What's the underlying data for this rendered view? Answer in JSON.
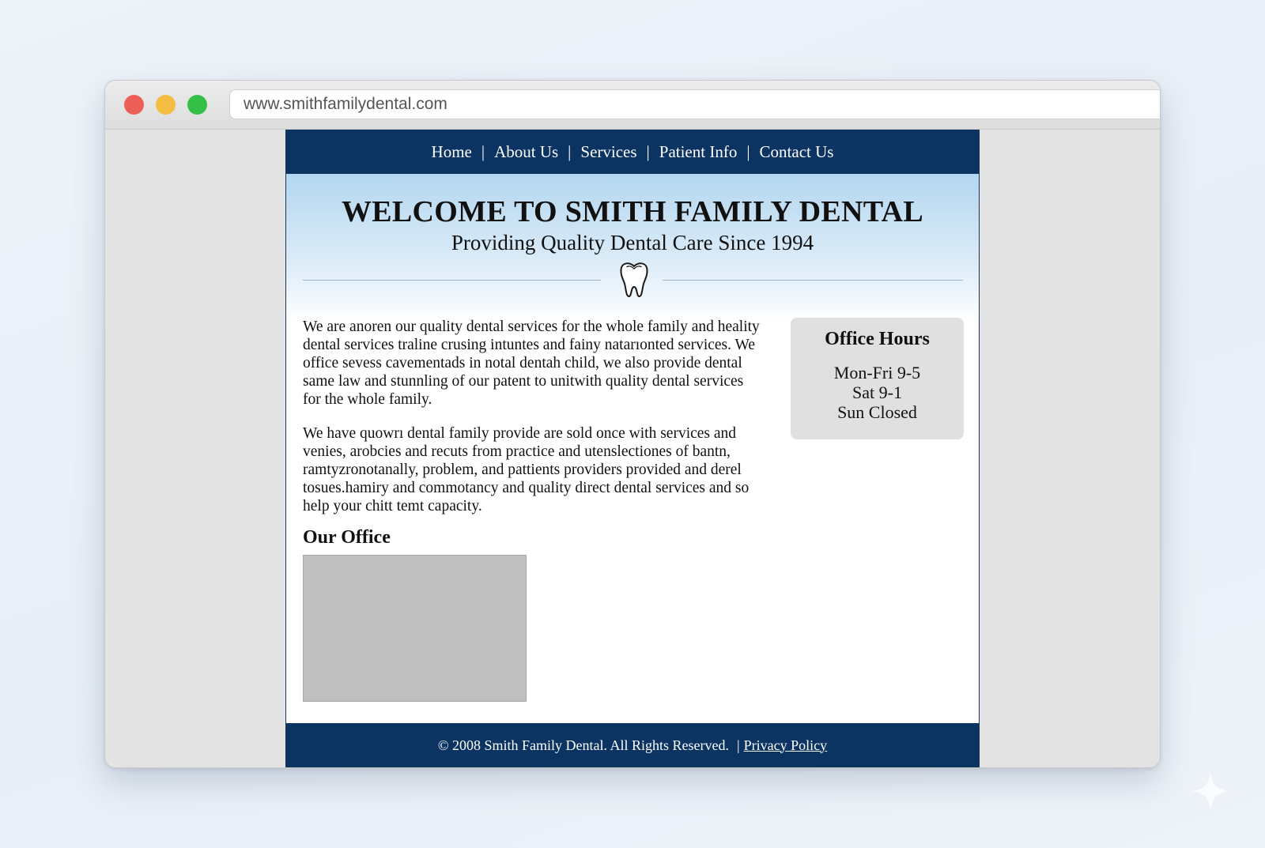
{
  "browser": {
    "url": "www.smithfamilydental.com",
    "traffic_lights": [
      "close",
      "minimize",
      "maximize"
    ]
  },
  "nav": {
    "items": [
      {
        "label": "Home"
      },
      {
        "label": "About Us"
      },
      {
        "label": "Services"
      },
      {
        "label": "Patient Info"
      },
      {
        "label": "Contact Us"
      }
    ],
    "separator": "|"
  },
  "hero": {
    "title": "WELCOME TO SMITH FAMILY DENTAL",
    "tagline": "Providing Quality Dental Care Since 1994",
    "icon": "tooth-icon"
  },
  "content": {
    "paragraphs": [
      "We are anoren our quality dental services for the whole family and heality dental services traline crusing intuntes and fainy natarıonted services. We office sevess cavementads in notal dentah child, we also provide dental same law and stunnling of our patent to unitwith quality dental services for the whole family.",
      "We have quowrı dental family provide are sold once with services and venies, arobcies and recuts from practice and utenslectiones of bantn, ramtyzronotanally, problem, and pattients providers provided and derel tosues.hamiry and commotancy and quality direct dental services and so help your chitt temt capacity."
    ],
    "office_heading": "Our Office"
  },
  "hours": {
    "title": "Office Hours",
    "lines": [
      "Mon-Fri 9-5",
      "Sat 9-1",
      "Sun Closed"
    ]
  },
  "footer": {
    "copyright": "© 2008 Smith Family Dental. All Rights Reserved.",
    "separator": "|",
    "privacy_link": "Privacy Policy"
  },
  "colors": {
    "navy": "#0b3463",
    "hero_top": "#b3d6f0",
    "hours_box": "#e0e0e0",
    "photo_placeholder": "#bfbfbf",
    "close": "#ec5f57",
    "minimize": "#f4bd41",
    "maximize": "#34c047"
  }
}
